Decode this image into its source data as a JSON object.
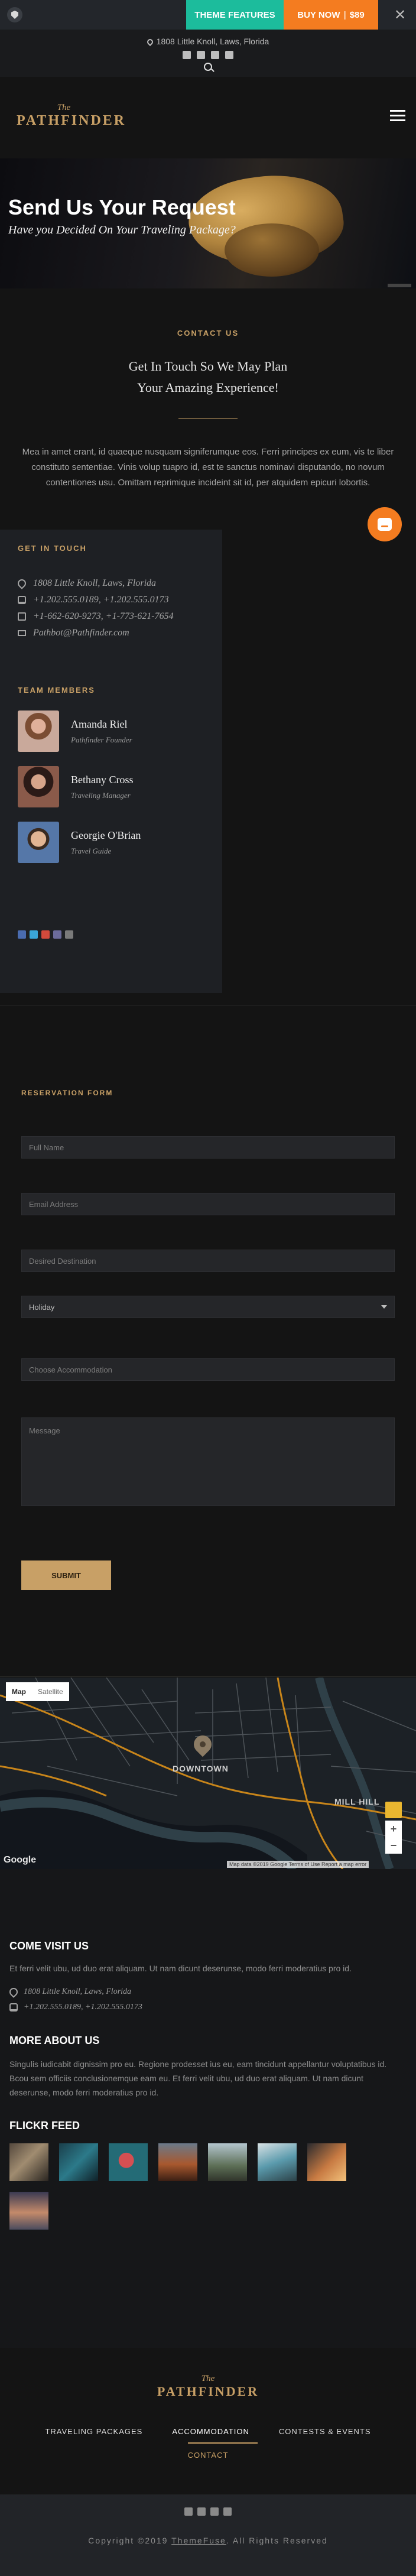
{
  "topbar": {
    "features_label": "THEME FEATURES",
    "buy_label": "BUY NOW",
    "price": "$89",
    "close_glyph": "✕"
  },
  "header": {
    "address": "1808 Little Knoll, Laws, Florida"
  },
  "logo": {
    "prefix": "The",
    "name": "PATHFINDER"
  },
  "hero": {
    "title": "Send Us Your Request",
    "subtitle": "Have you Decided On Your Traveling Package?"
  },
  "contact": {
    "kicker": "CONTACT US",
    "heading_1": "Get In Touch So We May Plan",
    "heading_2": "Your Amazing Experience!",
    "text": "Mea in amet erant, id quaeque nusquam signiferumque eos. Ferri principes ex eum, vis te liber constituto sententiae. Vinis volup tuapro id, est te sanctus nominavi disputando, no novum contentiones usu. Omittam reprimique incideint sit id, per atquidem epicuri lobortis."
  },
  "get_in_touch": {
    "title": "GET IN TOUCH",
    "address": "1808 Little Knoll, Laws, Florida",
    "phone": "+1.202.555.0189, +1.202.555.0173",
    "fax": "+1-662-620-9273, +1-773-621-7654",
    "email": "Pathbot@Pathfinder.com"
  },
  "team": {
    "title": "TEAM MEMBERS",
    "members": [
      {
        "name": "Amanda Riel",
        "role": "Pathfinder Founder"
      },
      {
        "name": "Bethany Cross",
        "role": "Traveling Manager"
      },
      {
        "name": "Georgie O'Brian",
        "role": "Travel Guide"
      }
    ]
  },
  "reservation": {
    "title": "RESERVATION FORM",
    "full_name": "Full Name",
    "email": "Email Address",
    "destination": "Desired Destination",
    "package_selected": "Holiday",
    "accommodation": "Choose Accommodation",
    "message": "Message",
    "submit": "SUBMIT"
  },
  "map": {
    "type_map": "Map",
    "type_satellite": "Satellite",
    "label_downtown": "DOWNTOWN",
    "label_mill": "MILL HILL",
    "brand": "Google",
    "footer": "Map data ©2019 Google   Terms of Use   Report a map error",
    "zoom_in": "+",
    "zoom_out": "−"
  },
  "visit": {
    "title": "COME VISIT US",
    "text": "Et ferri velit ubu, ud duo erat aliquam. Ut nam dicunt deserunse, modo ferri moderatius pro id.",
    "address": "1808 Little Knoll, Laws, Florida",
    "phone": "+1.202.555.0189, +1.202.555.0173"
  },
  "about": {
    "title": "MORE ABOUT US",
    "text": "Singulis iudicabit dignissim pro eu. Regione prodesset ius eu, eam tincidunt appellantur voluptatibus id. Bcou sem officiis conclusionemque eam eu. Et ferri velit ubu, ud duo erat aliquam. Ut nam dicunt deserunse, modo ferri moderatius pro id."
  },
  "flickr": {
    "title": "FLICKR FEED"
  },
  "footer_nav": {
    "item1": "TRAVELING PACKAGES",
    "item2": "ACCOMMODATION",
    "item3": "CONTESTS & EVENTS",
    "item4": "CONTACT"
  },
  "copyright": {
    "prefix": "Copyright ©2019",
    "brand": "ThemeFuse",
    "suffix": ". All Rights Reserved"
  },
  "colors": {
    "accent": "#c8a066",
    "teal": "#1cbc9c",
    "orange": "#f47c20"
  }
}
